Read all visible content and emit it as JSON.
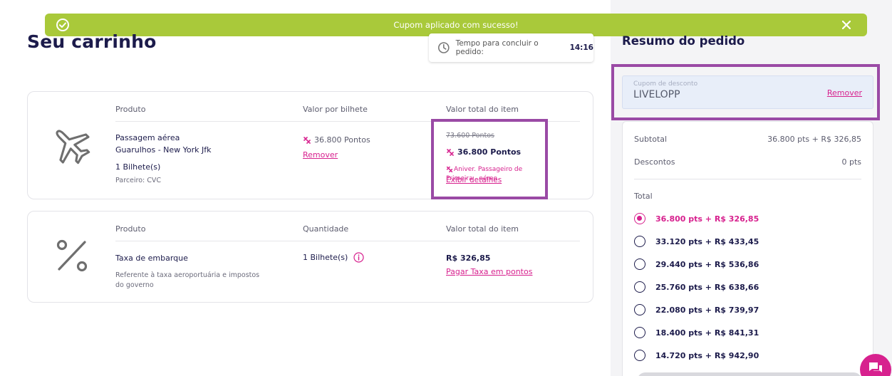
{
  "toast": {
    "message": "Cupom aplicado com sucesso!"
  },
  "page": {
    "title": "Seu carrinho"
  },
  "timer": {
    "label": "Tempo para concluir o pedido:",
    "value": "14:16"
  },
  "flight_item": {
    "col_product": "Produto",
    "col_unit": "Valor por bilhete",
    "col_total": "Valor total do item",
    "name": "Passagem aérea",
    "route": "Guarulhos - New York Jfk",
    "tickets": "1 Bilhete(s)",
    "partner": "Parceiro: CVC",
    "unit_value": "36.800 Pontos",
    "remove_label": "Remover",
    "old_total": "73.600 Pontos",
    "total": "36.800 Pontos",
    "promo": "Aniver. Passageiro de Primeira - aéreo",
    "details_link": "Exibir detalhes"
  },
  "tax_item": {
    "col_product": "Produto",
    "col_qty": "Quantidade",
    "col_total": "Valor total do item",
    "name": "Taxa de embarque",
    "description": "Referente à taxa aeroportuária e impostos do governo",
    "qty": "1 Bilhete(s)",
    "total": "R$ 326,85",
    "pay_points_link": "Pagar Taxa em pontos"
  },
  "summary": {
    "title": "Resumo do pedido",
    "coupon_label": "Cupom de desconto",
    "coupon_code": "LIVELOPP",
    "coupon_remove": "Remover",
    "subtotal_label": "Subtotal",
    "subtotal_value": "36.800 pts + R$ 326,85",
    "discount_label": "Descontos",
    "discount_value": "0 pts",
    "total_label": "Total",
    "options": [
      "36.800 pts + R$ 326,85",
      "33.120 pts + R$ 433,45",
      "29.440 pts + R$ 536,86",
      "25.760 pts + R$ 638,66",
      "22.080 pts + R$ 739,97",
      "18.400 pts + R$ 841,31",
      "14.720 pts + R$ 942,90"
    ],
    "selected_option": 0
  },
  "colors": {
    "accent": "#d7218e",
    "toast": "#a9c93a",
    "highlight": "#9a4aa5",
    "text_dark": "#1c1b4b"
  },
  "icons": {
    "toast_check": "check-circle-icon",
    "toast_close": "close-icon",
    "timer": "clock-icon",
    "flight": "airplane-icon",
    "tax": "percent-icon",
    "points": "points-icon",
    "info": "info-icon",
    "chat": "chat-icon"
  }
}
